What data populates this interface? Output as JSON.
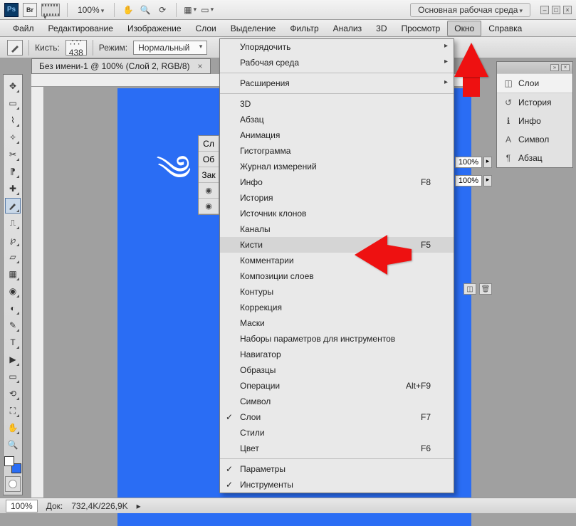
{
  "topbar": {
    "ps": "Ps",
    "br": "Br",
    "zoom": "100%",
    "workspace_label": "Основная рабочая среда"
  },
  "menu": {
    "items": [
      "Файл",
      "Редактирование",
      "Изображение",
      "Слои",
      "Выделение",
      "Фильтр",
      "Анализ",
      "3D",
      "Просмотр",
      "Окно",
      "Справка"
    ],
    "active_index": 9
  },
  "options": {
    "brush_label": "Кисть:",
    "brush_size": "438",
    "mode_label": "Режим:",
    "mode_value": "Нормальный"
  },
  "doc_tab": "Без имени-1 @ 100% (Слой 2, RGB/8)",
  "layers_stub": {
    "tabs": [
      "Сл"
    ],
    "btn1": "Об",
    "btn2": "Зак",
    "opacity1": "100%",
    "opacity2": "100%"
  },
  "window_menu": [
    {
      "label": "Упорядочить",
      "submenu": true
    },
    {
      "label": "Рабочая среда",
      "submenu": true
    },
    {
      "sep": true
    },
    {
      "label": "Расширения",
      "submenu": true
    },
    {
      "sep": true
    },
    {
      "label": "3D"
    },
    {
      "label": "Абзац"
    },
    {
      "label": "Анимация"
    },
    {
      "label": "Гистограмма"
    },
    {
      "label": "Журнал измерений"
    },
    {
      "label": "Инфо",
      "shortcut": "F8"
    },
    {
      "label": "История"
    },
    {
      "label": "Источник клонов"
    },
    {
      "label": "Каналы"
    },
    {
      "label": "Кисти",
      "shortcut": "F5",
      "hover": true
    },
    {
      "label": "Комментарии"
    },
    {
      "label": "Композиции слоев"
    },
    {
      "label": "Контуры"
    },
    {
      "label": "Коррекция"
    },
    {
      "label": "Маски"
    },
    {
      "label": "Наборы параметров для инструментов"
    },
    {
      "label": "Навигатор"
    },
    {
      "label": "Образцы"
    },
    {
      "label": "Операции",
      "shortcut": "Alt+F9"
    },
    {
      "label": "Символ"
    },
    {
      "label": "Слои",
      "shortcut": "F7",
      "checked": true
    },
    {
      "label": "Стили"
    },
    {
      "label": "Цвет",
      "shortcut": "F6"
    },
    {
      "sep": true
    },
    {
      "label": "Параметры",
      "checked": true
    },
    {
      "label": "Инструменты",
      "checked": true
    }
  ],
  "right_panel": {
    "items": [
      {
        "label": "Слои",
        "icon": "layers-icon",
        "selected": true
      },
      {
        "label": "История",
        "icon": "history-icon"
      },
      {
        "label": "Инфо",
        "icon": "info-icon"
      },
      {
        "label": "Символ",
        "icon": "character-icon"
      },
      {
        "label": "Абзац",
        "icon": "paragraph-icon"
      }
    ]
  },
  "status": {
    "zoom": "100%",
    "doc_label": "Док:",
    "doc_value": "732,4K/226,9K"
  },
  "colors": {
    "canvas": "#2a6df4",
    "arrow": "#e11111"
  }
}
